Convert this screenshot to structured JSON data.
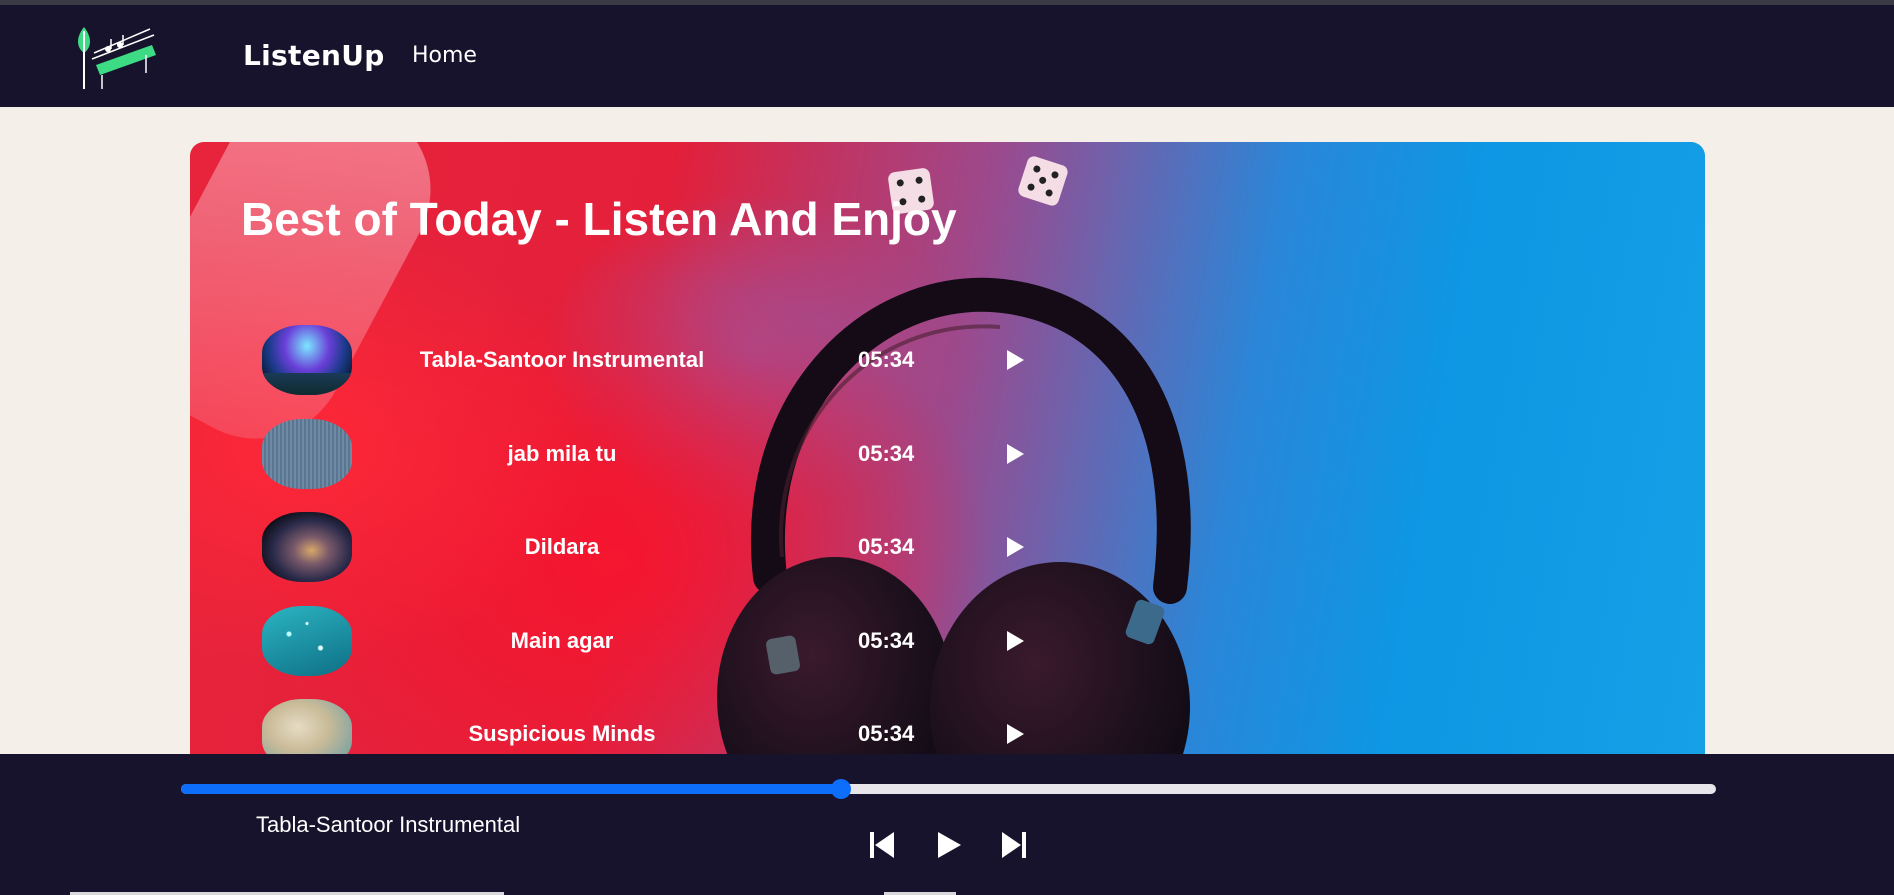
{
  "nav": {
    "brand": "ListenUp",
    "home_label": "Home",
    "logo_icon": "leaf-piano-logo"
  },
  "hero": {
    "title": "Best of Today - Listen And Enjoy",
    "colors": {
      "red": "#e8243c",
      "blue": "#0d97e4"
    }
  },
  "tracks": [
    {
      "name": "Tabla-Santoor Instrumental",
      "duration": "05:34",
      "thumb": "aurora-thumbnail"
    },
    {
      "name": "jab mila tu",
      "duration": "05:34",
      "thumb": "denim-thumbnail"
    },
    {
      "name": "Dildara",
      "duration": "05:34",
      "thumb": "milky-way-thumbnail"
    },
    {
      "name": "Main agar",
      "duration": "05:34",
      "thumb": "teal-sparkle-thumbnail"
    },
    {
      "name": "Suspicious Minds",
      "duration": "05:34",
      "thumb": "sandy-map-thumbnail"
    }
  ],
  "player": {
    "now_playing": "Tabla-Santoor Instrumental",
    "progress": 0.43,
    "colors": {
      "accent": "#0e6efc",
      "background": "#17132c"
    }
  }
}
